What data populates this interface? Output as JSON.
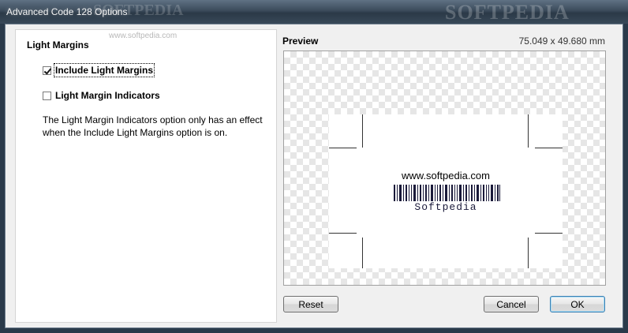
{
  "window": {
    "title": "Advanced Code 128 Options",
    "watermark": "SOFTPEDIA",
    "watermark_small": "SOFTPEDIA",
    "watermark_url": "www.softpedia.com"
  },
  "light_margins": {
    "section_title": "Light Margins",
    "include_label": "Include Light Margins",
    "include_checked": true,
    "indicators_label": "Light Margin Indicators",
    "indicators_checked": false,
    "note": "The Light Margin Indicators option only has an effect when the Include Light Margins option is on."
  },
  "preview": {
    "title": "Preview",
    "dimensions": "75.049 x 49.680 mm",
    "card_url": "www.softpedia.com",
    "card_text": "Softpedia"
  },
  "buttons": {
    "reset": "Reset",
    "cancel": "Cancel",
    "ok": "OK"
  },
  "colors": {
    "titlebar": "#3b4b5b",
    "panel_bg": "#f0f0f0",
    "default_button_border": "#3c7fb1"
  }
}
